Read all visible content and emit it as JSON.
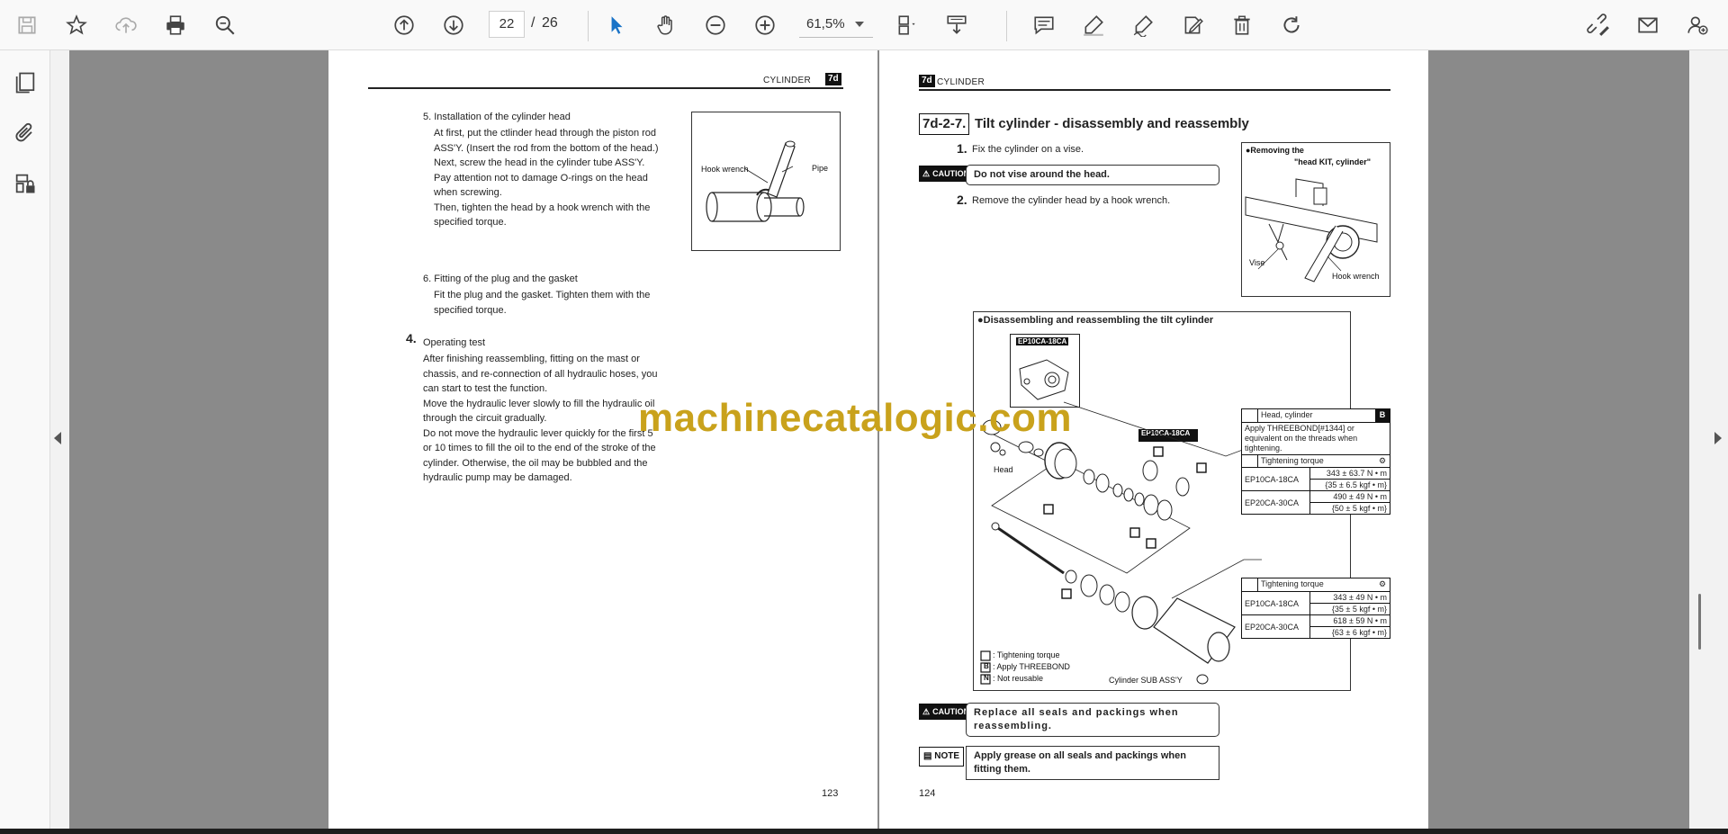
{
  "toolbar": {
    "page_current": "22",
    "page_separator": "/",
    "page_total": "26",
    "zoom": "61,5%"
  },
  "left_page": {
    "header_title": "CYLINDER",
    "header_badge": "7d",
    "step5_title": "5. Installation of the cylinder head",
    "step5_lines": [
      "At first, put the ctlinder head through the piston rod",
      "ASS'Y. (Insert the rod from the bottom of the head.)",
      "Next, screw the head in the cylinder tube ASS'Y.",
      "Pay attention not to damage O-rings on the head",
      "when screwing.",
      "Then, tighten the head by a hook wrench with the",
      "specified torque."
    ],
    "fig1_label_hook": "Hook wrench",
    "fig1_label_pipe": "Pipe",
    "step6_title": "6. Fitting of the plug and the gasket",
    "step6_lines": [
      "Fit the plug and the gasket. Tighten them with the",
      "specified torque."
    ],
    "step4_num": "4.",
    "step4_title": "Operating test",
    "step4_lines": [
      "After finishing reassembling, fitting on the mast or",
      "chassis, and re-connection of all hydraulic hoses, you",
      "can start to test the function.",
      "Move the hydraulic lever slowly to fill the hydraulic oil",
      "through the circuit gradually.",
      "Do not move the hydraulic lever quickly for the first 5",
      "or 10 times to fill the oil to the end of the stroke of the",
      "cylinder. Otherwise, the oil may be bubbled and the",
      "hydraulic pump may be damaged."
    ],
    "page_number": "123"
  },
  "right_page": {
    "header_badge": "7d",
    "header_title": "CYLINDER",
    "section_num": "7d-2-7.",
    "section_title": "Tilt cylinder - disassembly and reassembly",
    "step1_num": "1.",
    "step1_text": "Fix the cylinder on a vise.",
    "caution_label": "CAUTION",
    "caution1_text": "Do not vise around the head.",
    "step2_num": "2.",
    "step2_text": "Remove the cylinder head by a hook wrench.",
    "fig_removing_title": "●Removing the",
    "fig_removing_title2": "\"head KIT, cylinder\"",
    "fig_vise": "Vise",
    "fig_hookwrench": "Hook wrench",
    "diag_title": "●Disassembling and reassembling the tilt cylinder",
    "diag_ep_badge1": "EP10CA-18CA",
    "diag_ep_badge2": "EP10CA-18CA",
    "diag_head": "Head",
    "diag_legend": [
      ": Tightening torque",
      ": Apply THREEBOND",
      ": Not reusable"
    ],
    "diag_legend_letters": [
      "",
      "B",
      "N"
    ],
    "diag_cyl_sub": "Cylinder SUB ASS'Y",
    "table1": {
      "title": "Head, cylinder",
      "letter": "B",
      "note": "Apply THREEBOND[#1344] or equivalent on the threads when tightening.",
      "subtitle": "Tightening torque",
      "rows": [
        {
          "model": "EP10CA-18CA",
          "v1": "343 ± 63.7 N • m",
          "v2": "{35 ± 6.5 kgf • m}"
        },
        {
          "model": "EP20CA-30CA",
          "v1": "490 ± 49 N • m",
          "v2": "{50 ± 5 kgf • m}"
        }
      ]
    },
    "table2": {
      "subtitle": "Tightening torque",
      "rows": [
        {
          "model": "EP10CA-18CA",
          "v1": "343 ± 49 N • m",
          "v2": "{35 ± 5 kgf • m}"
        },
        {
          "model": "EP20CA-30CA",
          "v1": "618 ± 59 N • m",
          "v2": "{63 ± 6 kgf • m}"
        }
      ]
    },
    "caution2_text": "Replace all seals and packings when reassembling.",
    "note_label": "NOTE",
    "note_text": "Apply grease on all seals and packings when fitting them.",
    "page_number": "124"
  },
  "watermark": "machinecatalogic.com"
}
